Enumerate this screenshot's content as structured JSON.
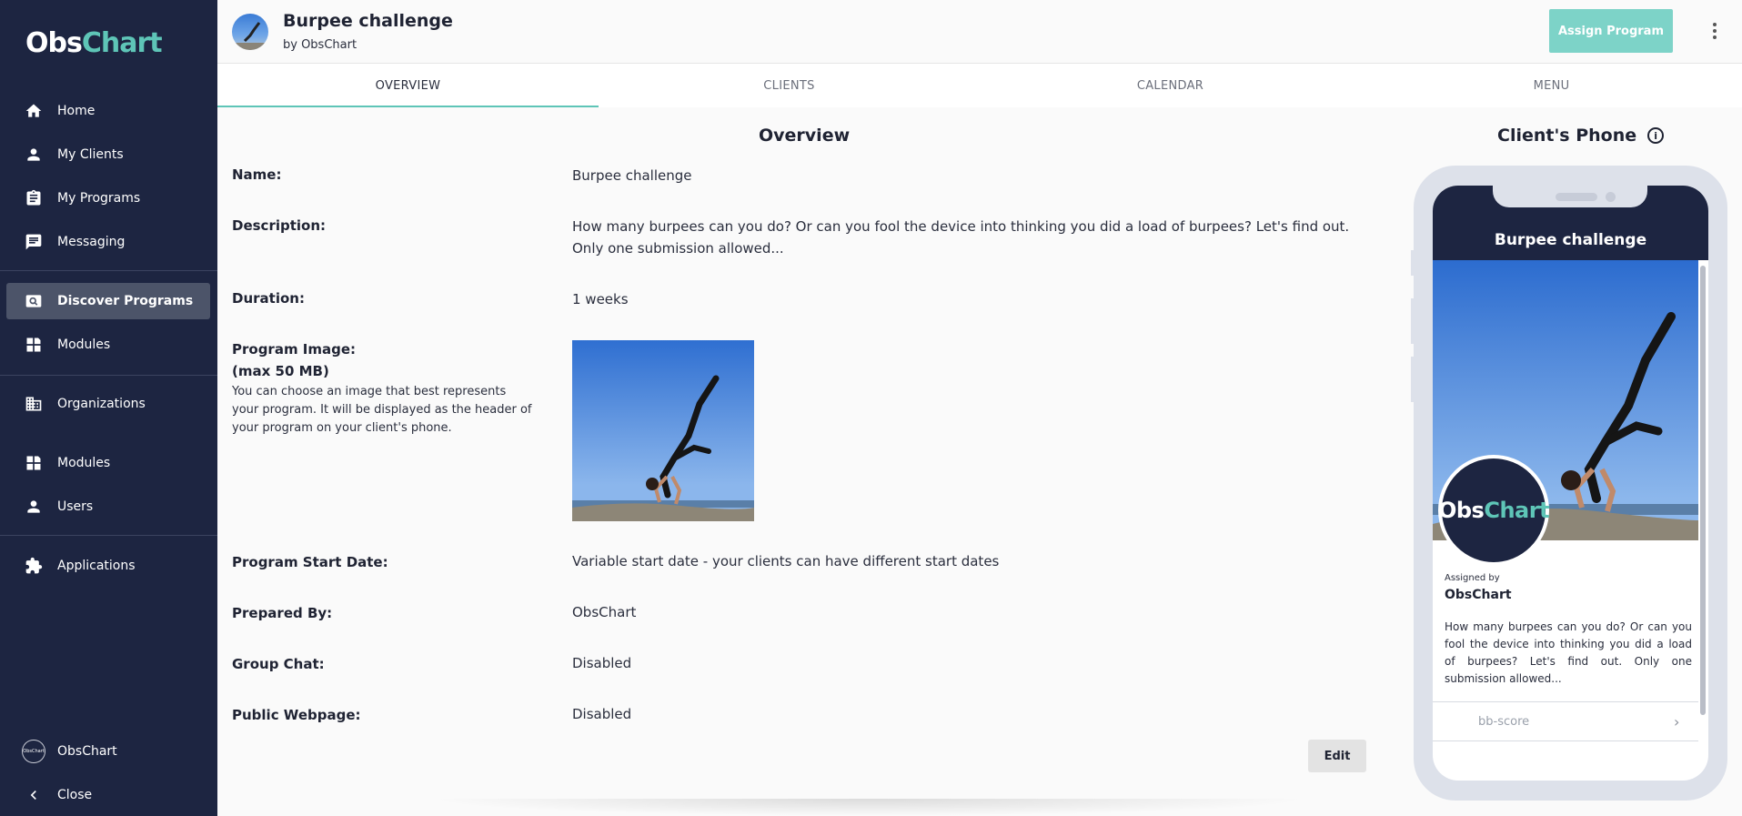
{
  "app": {
    "logo_part1": "Obs",
    "logo_part2": "Chart"
  },
  "sidebar": {
    "items": [
      {
        "label": "Home",
        "icon": "home-icon"
      },
      {
        "label": "My Clients",
        "icon": "person-icon"
      },
      {
        "label": "My Programs",
        "icon": "clipboard-icon"
      },
      {
        "label": "Messaging",
        "icon": "chat-icon"
      },
      {
        "label": "Discover Programs",
        "icon": "search-box-icon",
        "active": true
      },
      {
        "label": "Modules",
        "icon": "dashboard-icon"
      },
      {
        "label": "Organizations",
        "icon": "building-icon"
      },
      {
        "label": "Modules",
        "icon": "dashboard-icon"
      },
      {
        "label": "Users",
        "icon": "person-icon"
      },
      {
        "label": "Applications",
        "icon": "puzzle-icon"
      }
    ],
    "account": {
      "label": "ObsChart",
      "avatar_text": "ObsChart"
    },
    "close": {
      "label": "Close",
      "icon": "chevron-left-icon"
    }
  },
  "header": {
    "title": "Burpee challenge",
    "subtitle": "by ObsChart",
    "assign_label": "Assign Program"
  },
  "tabs": [
    {
      "label": "OVERVIEW",
      "active": true
    },
    {
      "label": "CLIENTS"
    },
    {
      "label": "CALENDAR"
    },
    {
      "label": "MENU"
    }
  ],
  "overview": {
    "title": "Overview",
    "fields": {
      "name_label": "Name:",
      "name_value": "Burpee challenge",
      "description_label": "Description:",
      "description_value": "How many burpees can you do? Or can you fool the device into thinking you did a load of burpees? Let's find out. Only one submission allowed...",
      "duration_label": "Duration:",
      "duration_value": "1 weeks",
      "image_label": "Program Image:",
      "image_max": "(max 50 MB)",
      "image_help": "You can choose an image that best represents your program. It will be displayed as the header of your program on your client's phone.",
      "start_label": "Program Start Date:",
      "start_value": "Variable start date - your clients can have different start dates",
      "prepared_label": "Prepared By:",
      "prepared_value": "ObsChart",
      "group_chat_label": "Group Chat:",
      "group_chat_value": "Disabled",
      "webpage_label": "Public Webpage:",
      "webpage_value": "Disabled"
    },
    "edit_label": "Edit"
  },
  "phone_preview": {
    "title": "Client's Phone",
    "program_title": "Burpee challenge",
    "logo_part1": "Obs",
    "logo_part2": "Chart",
    "assigned_by_label": "Assigned by",
    "assigned_by_name": "ObsChart",
    "description": "How many burpees can you do? Or can you fool the device into thinking you did a load of burpees? Let's find out. Only one submission allowed...",
    "module_label": "bb-score"
  },
  "colors": {
    "sidebar_bg": "#1d2541",
    "accent": "#5ec5b7",
    "assign_button": "#7dd3c8"
  }
}
